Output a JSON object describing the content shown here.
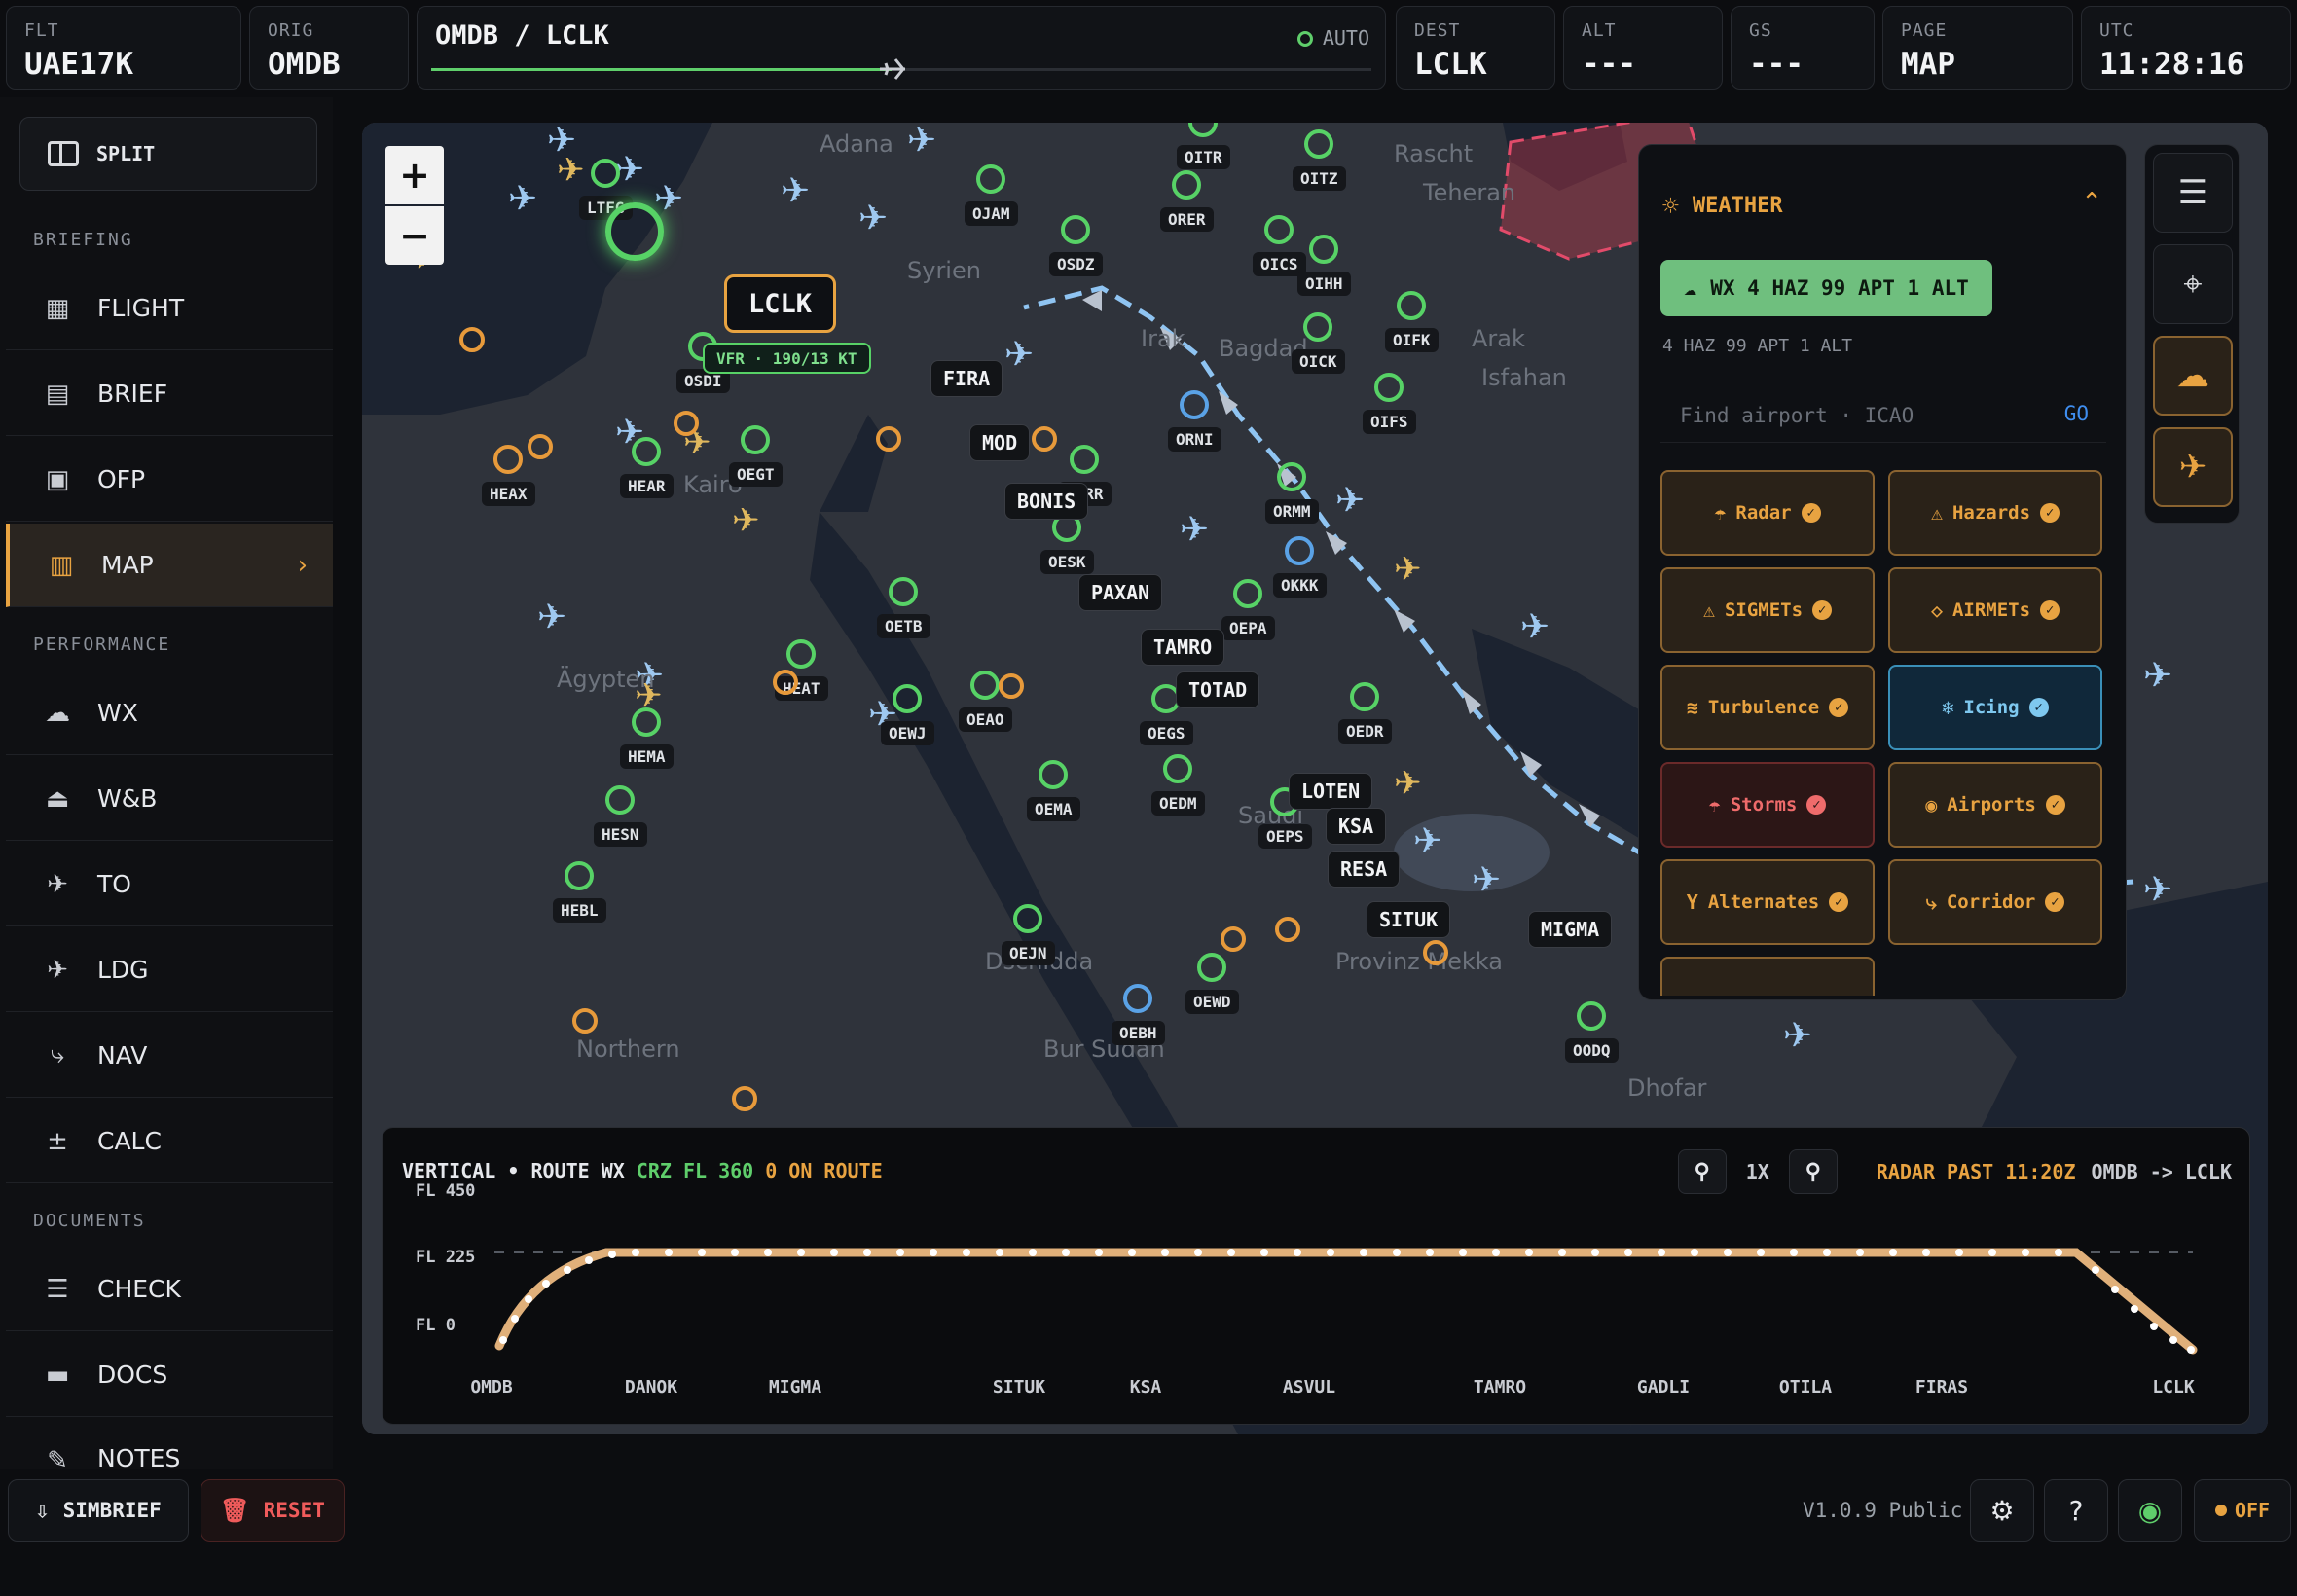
{
  "topbar": {
    "flt": {
      "label": "FLT",
      "value": "UAE17K"
    },
    "orig": {
      "label": "ORIG",
      "value": "OMDB"
    },
    "route": {
      "text": "OMDB / LCLK",
      "mode": "AUTO",
      "progress": 0.49
    },
    "dest": {
      "label": "DEST",
      "value": "LCLK"
    },
    "alt": {
      "label": "ALT",
      "value": "---"
    },
    "gs": {
      "label": "GS",
      "value": "---"
    },
    "page": {
      "label": "PAGE",
      "value": "MAP"
    },
    "utc": {
      "label": "UTC",
      "value": "11:28:16"
    }
  },
  "sidebar": {
    "split_label": "SPLIT",
    "sections": {
      "briefing": "BRIEFING",
      "performance": "PERFORMANCE",
      "documents": "DOCUMENTS"
    },
    "items": [
      {
        "label": "FLIGHT",
        "icon": "grid-icon"
      },
      {
        "label": "BRIEF",
        "icon": "document-icon"
      },
      {
        "label": "OFP",
        "icon": "clipboard-icon"
      },
      {
        "label": "MAP",
        "icon": "map-icon"
      },
      {
        "label": "WX",
        "icon": "cloud-sun-icon"
      },
      {
        "label": "W&B",
        "icon": "weight-icon"
      },
      {
        "label": "TO",
        "icon": "takeoff-icon"
      },
      {
        "label": "LDG",
        "icon": "landing-icon"
      },
      {
        "label": "NAV",
        "icon": "route-icon"
      },
      {
        "label": "CALC",
        "icon": "calculator-icon"
      },
      {
        "label": "CHECK",
        "icon": "checklist-icon"
      },
      {
        "label": "DOCS",
        "icon": "folder-icon"
      },
      {
        "label": "NOTES",
        "icon": "pen-icon"
      }
    ]
  },
  "map": {
    "zoom_in": "+",
    "zoom_out": "−",
    "dest_label": "LCLK",
    "dest_info": "VFR · 190/13 KT",
    "waypoints": [
      "FIRA",
      "BONIS",
      "PAXAN",
      "TAMRO",
      "TOTAD",
      "LOTEN",
      "KSA",
      "RESA",
      "SITUK",
      "MIGMA",
      "MOD"
    ],
    "airports": [
      "LTFG",
      "OSDI",
      "OEGT",
      "HEAX",
      "HEAR",
      "OERR",
      "OESK",
      "OETB",
      "OEWJ",
      "OEAO",
      "HEMA",
      "OEMA",
      "HESN",
      "HEBL",
      "OEJN",
      "OEBH",
      "OEWD",
      "OEGS",
      "OEDM",
      "OEPS",
      "OEPA",
      "ORMM",
      "OKKK",
      "ORNI",
      "ORER",
      "OITR",
      "OITZ",
      "OICS",
      "OIHH",
      "OICK",
      "OIFK",
      "OIFS",
      "OSDZ",
      "OODQ",
      "OEDR",
      "OJAM",
      "HEAT"
    ]
  },
  "weather": {
    "title": "WEATHER",
    "summary": "WX 4 HAZ 99 APT 1 ALT",
    "subtext": "4 HAZ 99 APT 1 ALT",
    "search_placeholder": "Find airport · ICAO",
    "go_label": "GO",
    "toggles": [
      {
        "label": "Radar",
        "state": "on"
      },
      {
        "label": "Hazards",
        "state": "on"
      },
      {
        "label": "SIGMETs",
        "state": "on"
      },
      {
        "label": "AIRMETs",
        "state": "on"
      },
      {
        "label": "Turbulence",
        "state": "on"
      },
      {
        "label": "Icing",
        "state": "on"
      },
      {
        "label": "Storms",
        "state": "on"
      },
      {
        "label": "Airports",
        "state": "on"
      },
      {
        "label": "Alternates",
        "state": "on"
      },
      {
        "label": "Corridor",
        "state": "on"
      }
    ]
  },
  "vertical": {
    "title": "VERTICAL • ROUTE WX",
    "cruise": "CRZ FL 360",
    "on_route": "0 ON ROUTE",
    "zoom": "1X",
    "radar": "RADAR PAST 11:20Z",
    "od": "OMDB -> LCLK",
    "y_labels": [
      "FL 450",
      "FL 225",
      "FL 0"
    ],
    "x_labels": [
      "OMDB",
      "DANOK",
      "MIGMA",
      "SITUK",
      "KSA",
      "ASVUL",
      "TAMRO",
      "GADLI",
      "OTILA",
      "FIRAS",
      "LCLK"
    ]
  },
  "bottombar": {
    "simbrief": "SIMBRIEF",
    "reset": "RESET",
    "version": "V1.0.9 Public",
    "off": "OFF"
  },
  "colors": {
    "accent": "#e8a341",
    "green": "#5fce6b",
    "blue": "#3f8ef0",
    "red": "#ef5b5b"
  }
}
